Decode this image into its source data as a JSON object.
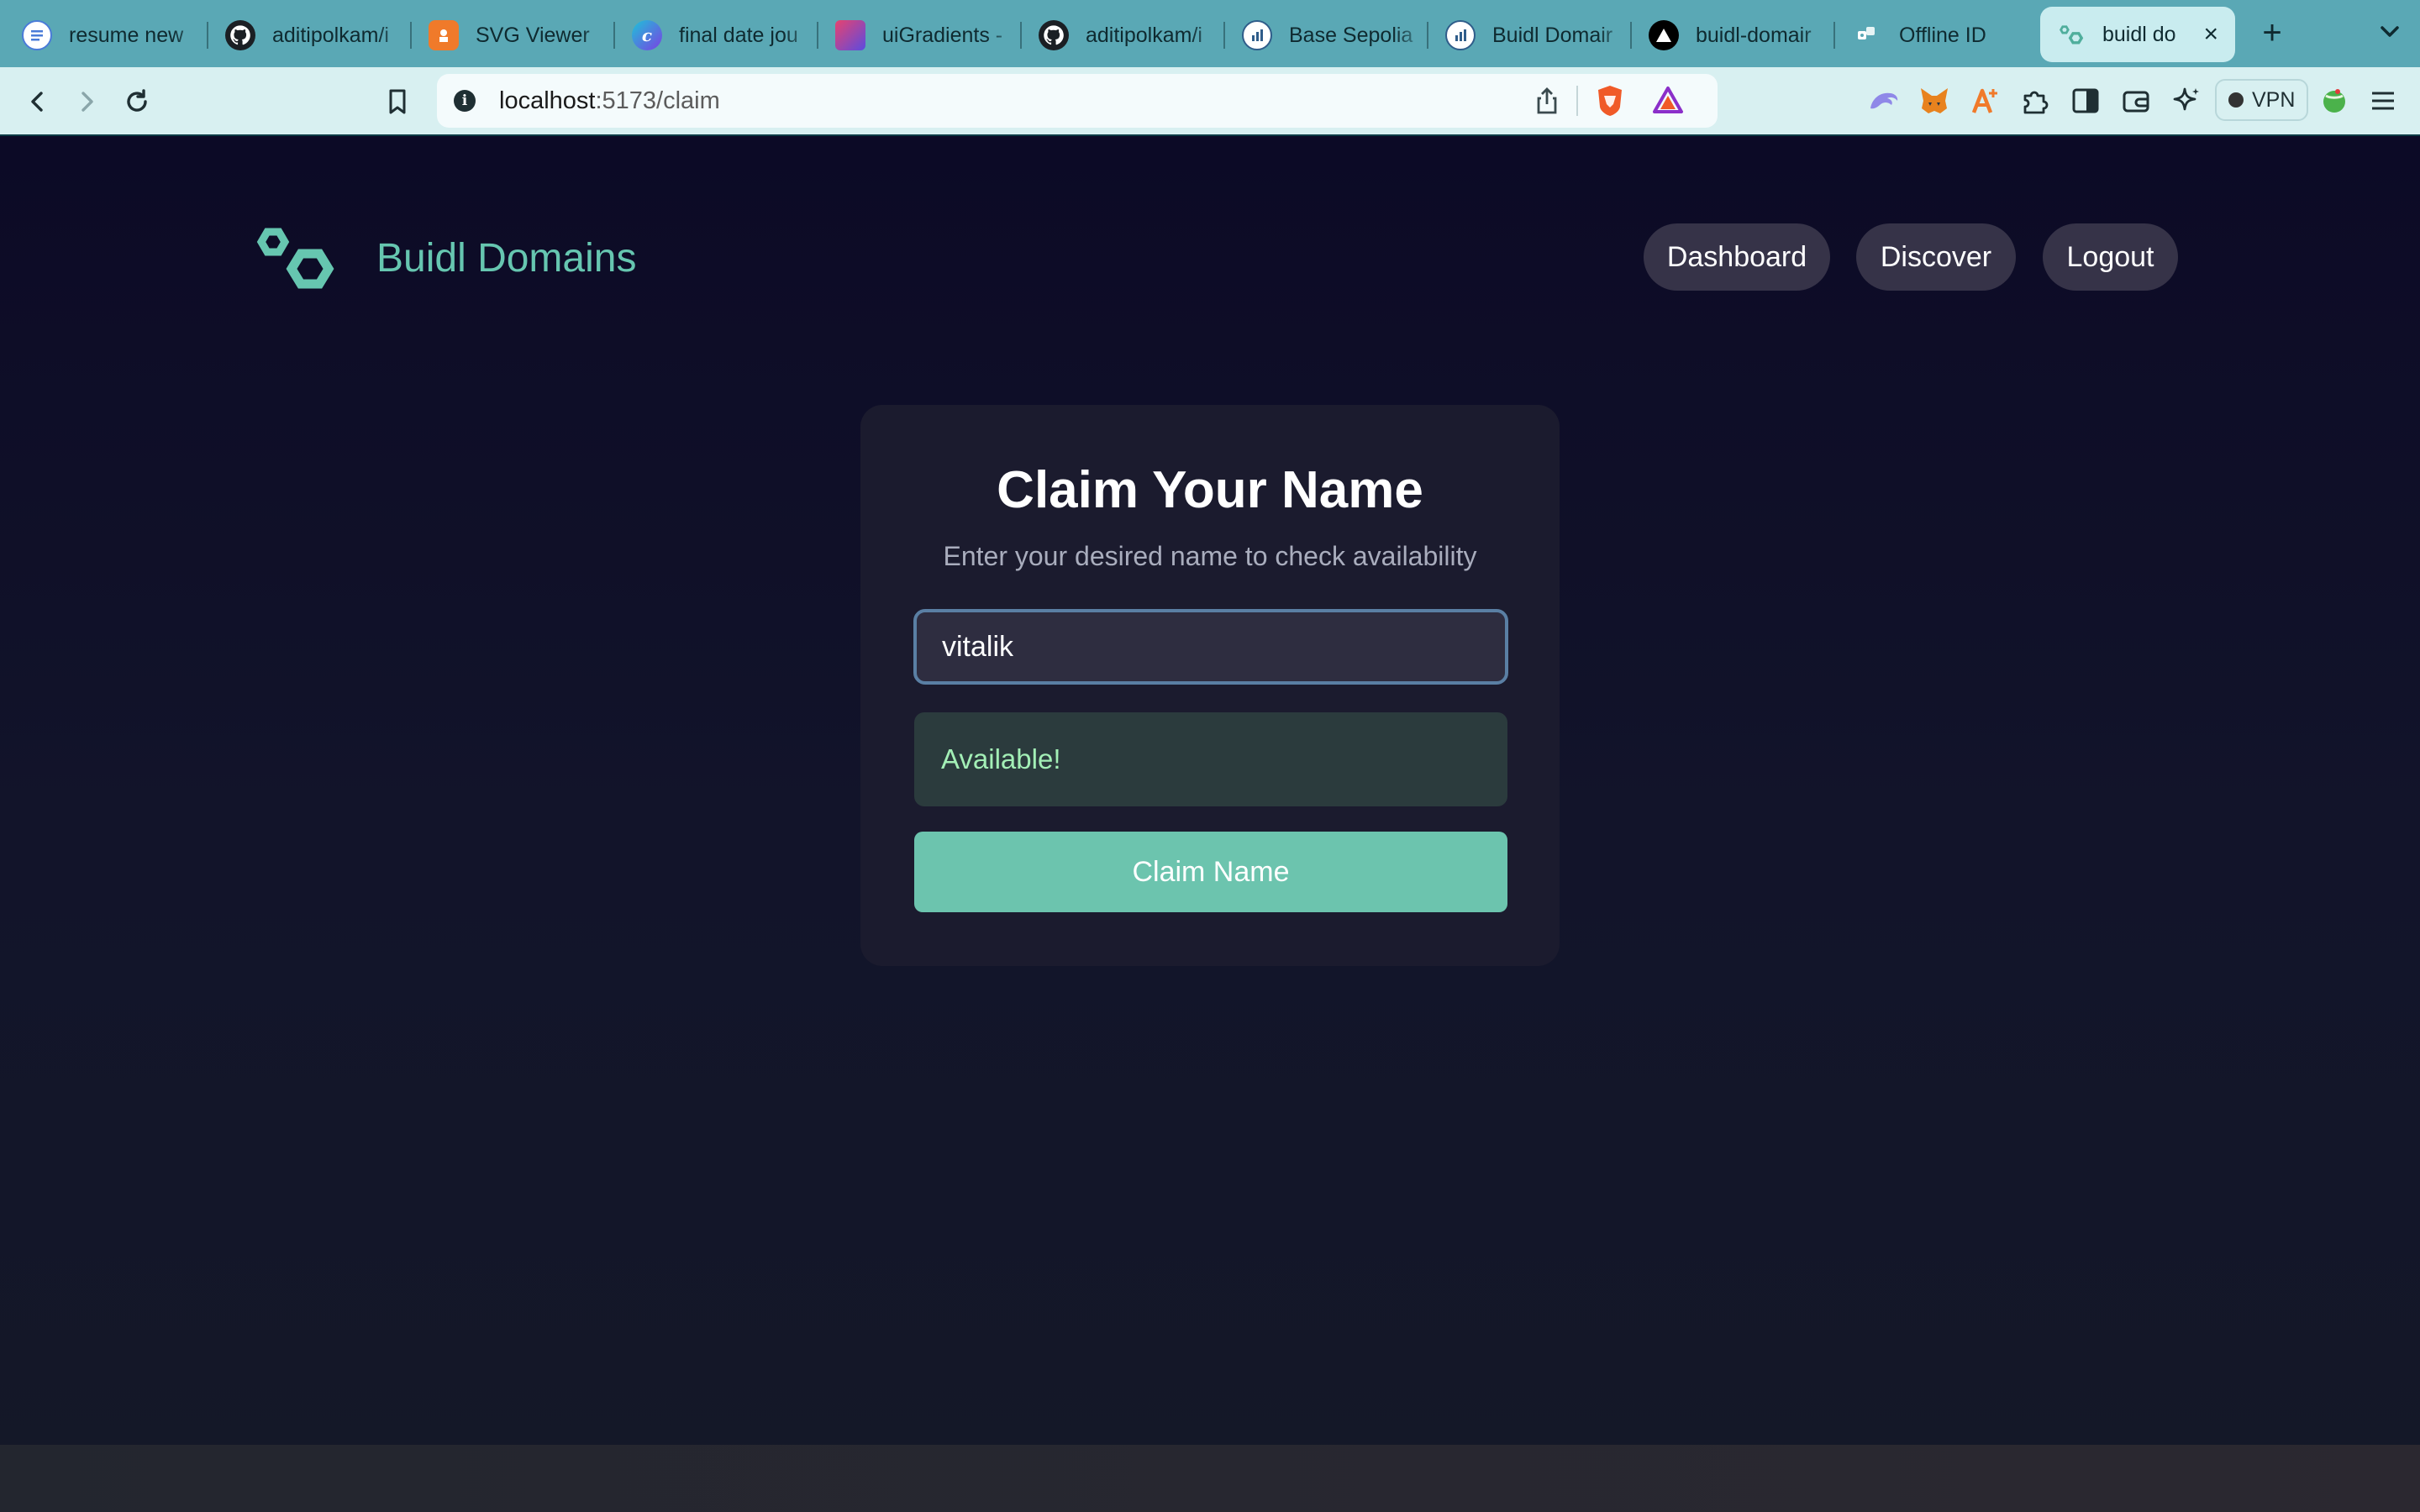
{
  "browser": {
    "tabs": [
      {
        "title": "resume new",
        "icon": "docs-icon",
        "color": "#4a7bd8"
      },
      {
        "title": "aditipolkam/i",
        "icon": "github-icon",
        "color": "#1b1f24"
      },
      {
        "title": "SVG Viewer",
        "icon": "svg-viewer-icon",
        "color": "#f07a2a"
      },
      {
        "title": "final date jou",
        "icon": "canva-icon",
        "color": "#5b55e8"
      },
      {
        "title": "uiGradients -",
        "icon": "gradient-icon",
        "color": "#c0457a"
      },
      {
        "title": "aditipolkam/i",
        "icon": "github-icon",
        "color": "#1b1f24"
      },
      {
        "title": "Base Sepolia",
        "icon": "basescan-icon",
        "color": "#ffffff"
      },
      {
        "title": "Buidl Domair",
        "icon": "basescan-icon",
        "color": "#ffffff"
      },
      {
        "title": "buidl-domair",
        "icon": "vercel-icon",
        "color": "#000000"
      },
      {
        "title": "Offline ID",
        "icon": "offline-id-icon",
        "color": "#ffffff"
      },
      {
        "title": "buidl do",
        "icon": "buidl-hex-icon",
        "color": "#66c6b0",
        "active": true
      }
    ],
    "url_host": "localhost",
    "url_path": ":5173/claim"
  },
  "header": {
    "brand": "Buidl Domains",
    "nav": [
      "Dashboard",
      "Discover",
      "Logout"
    ],
    "accent_color": "#66c6b0"
  },
  "claim": {
    "title": "Claim Your Name",
    "subtitle": "Enter your desired name to check availability",
    "input_value": "vitalik",
    "status": "Available!",
    "button": "Claim Name"
  },
  "extensions": [
    "arc-icon",
    "metamask-icon",
    "extension-a-icon",
    "puzzle-icon",
    "sidebar-icon",
    "wallet-icon",
    "leo-ai-icon",
    "vpn-badge",
    "green-ball-icon",
    "menu-icon"
  ],
  "vpn_label": "VPN"
}
